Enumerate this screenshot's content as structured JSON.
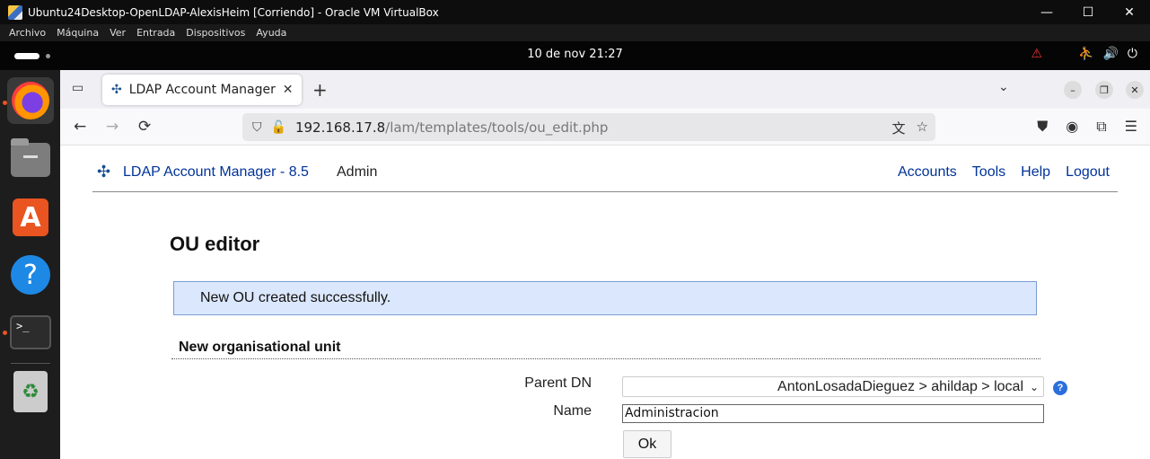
{
  "vbox": {
    "title": "Ubuntu24Desktop-OpenLDAP-AlexisHeim [Corriendo] - Oracle VM VirtualBox",
    "menu": [
      "Archivo",
      "Máquina",
      "Ver",
      "Entrada",
      "Dispositivos",
      "Ayuda"
    ],
    "winctl": {
      "minimize": "—",
      "maximize": "☐",
      "close": "✕"
    }
  },
  "gnome": {
    "clock": "10 de nov  21:27",
    "tray": {
      "warning": "⚠",
      "accessibility": "⛹",
      "volume": "🔊",
      "power": "⏻"
    }
  },
  "dock": {
    "store_glyph": "A",
    "help_glyph": "?",
    "terminal_glyph": ">_",
    "trash_glyph": "♻"
  },
  "browser": {
    "tab": {
      "title": "LDAP Account Manager (l",
      "favicon": "✣",
      "close": "✕"
    },
    "new_tab": "+",
    "url": {
      "host": "192.168.17.8",
      "path": "/lam/templates/tools/ou_edit.php"
    },
    "icons": {
      "back": "←",
      "forward": "→",
      "reload": "⟳",
      "shield": "⛉",
      "lock": "🔓",
      "translate": "文",
      "star": "☆",
      "pocket": "⛊",
      "account": "◉",
      "extensions": "⧉",
      "menu": "☰",
      "overflow": "⌄"
    },
    "window_buttons": {
      "minimize": "–",
      "restore": "❐",
      "close": "✕"
    }
  },
  "lam": {
    "brand": "LDAP Account Manager - 8.5",
    "user": "Admin",
    "menu": [
      "Accounts",
      "Tools",
      "Help",
      "Logout"
    ],
    "page_title": "OU editor",
    "success_message": "New OU created successfully.",
    "section_title": "New organisational unit",
    "parent_dn_label": "Parent DN",
    "parent_dn_value": "AntonLosadaDieguez > ahildap > local",
    "name_label": "Name",
    "name_value": "Administracion",
    "ok_label": "Ok",
    "help_glyph": "?"
  }
}
